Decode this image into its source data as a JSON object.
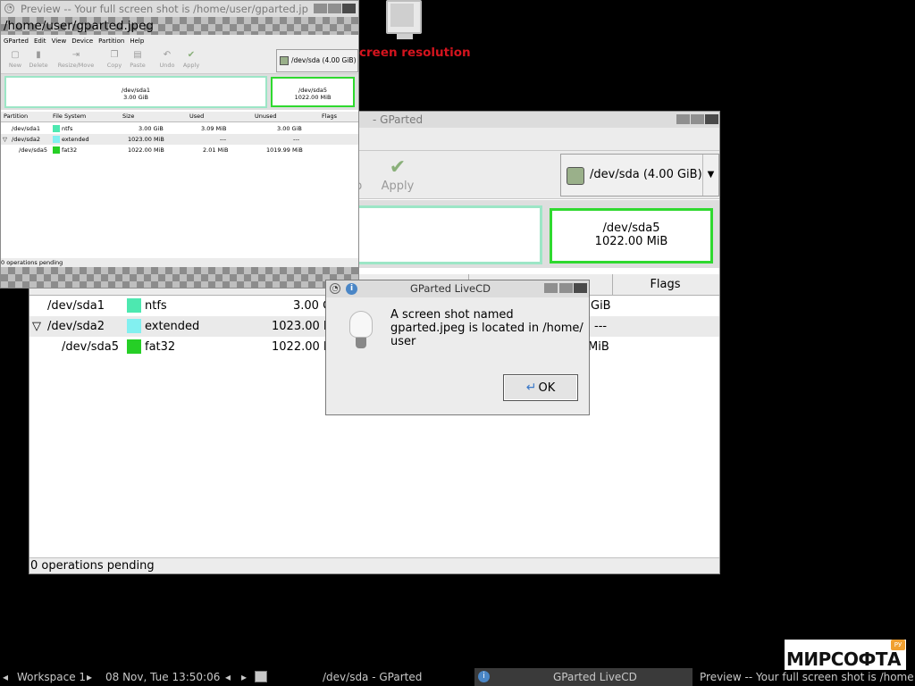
{
  "desktop": {
    "icon_label": "creen resolution"
  },
  "main_window": {
    "title": "- GParted",
    "toolbar": {
      "apply_fragment": "p",
      "apply_label": "Apply"
    },
    "device_selector": "/dev/sda  (4.00 GiB)",
    "visual": {
      "sda5_name": "/dev/sda5",
      "sda5_size": "1022.00 MiB"
    },
    "headers": {
      "flags": "Flags"
    },
    "rows": [
      {
        "partition": "/dev/sda1",
        "fs": "ntfs",
        "size": "3.00 G",
        "tail": "GiB",
        "color": "#4de8b0",
        "expander": ""
      },
      {
        "partition": "/dev/sda2",
        "fs": "extended",
        "size": "1023.00 M",
        "tail": "---",
        "color": "#82f0f0",
        "expander": "▽"
      },
      {
        "partition": "/dev/sda5",
        "fs": "fat32",
        "size": "1022.00 M",
        "tail": "MiB",
        "color": "#26cf26",
        "expander": ""
      }
    ],
    "status": "0 operations pending"
  },
  "preview_window": {
    "title": "Preview -- Your full screen shot is /home/user/gparted.jp",
    "path": "/home/user/gparted.jpeg",
    "menu": [
      "GParted",
      "Edit",
      "View",
      "Device",
      "Partition",
      "Help"
    ],
    "toolbar": [
      "New",
      "Delete",
      "Resize/Move",
      "Copy",
      "Paste",
      "Undo",
      "Apply"
    ],
    "device_selector": "/dev/sda   (4.00 GiB)",
    "visual": {
      "sda1_name": "/dev/sda1",
      "sda1_size": "3.00 GiB",
      "sda5_name": "/dev/sda5",
      "sda5_size": "1022.00 MiB"
    },
    "headers": [
      "Partition",
      "File System",
      "Size",
      "Used",
      "Unused",
      "Flags"
    ],
    "rows": [
      {
        "partition": "/dev/sda1",
        "fs": "ntfs",
        "size": "3.00 GiB",
        "used": "3.09 MiB",
        "unused": "3.00 GiB",
        "color": "#4de8b0",
        "expander": ""
      },
      {
        "partition": "/dev/sda2",
        "fs": "extended",
        "size": "1023.00 MiB",
        "used": "---",
        "unused": "---",
        "color": "#82f0f0",
        "expander": "▽"
      },
      {
        "partition": "/dev/sda5",
        "fs": "fat32",
        "size": "1022.00 MiB",
        "used": "2.01 MiB",
        "unused": "1019.99 MiB",
        "color": "#26cf26",
        "expander": ""
      }
    ],
    "status": "0 operations pending"
  },
  "dialog": {
    "title": "GParted LiveCD",
    "message": "A screen shot named gparted.jpeg is located in /home/ user",
    "ok_label": "OK"
  },
  "taskbar": {
    "workspace": "Workspace 1",
    "clock": "08 Nov, Tue 13:50:06",
    "task_gparted": "/dev/sda - GParted",
    "task_dialog": "GParted LiveCD",
    "task_preview": "Preview -- Your full screen shot is /home"
  },
  "watermark": {
    "text": "МИРСОФТА",
    "badge": "РУ"
  }
}
